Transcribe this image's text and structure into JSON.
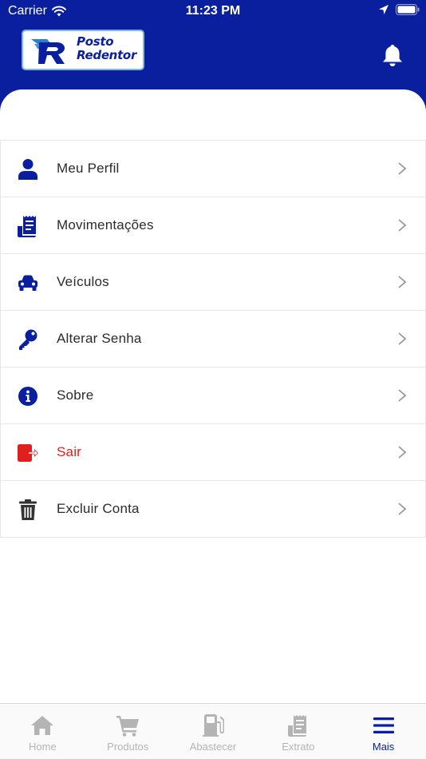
{
  "status_bar": {
    "carrier": "Carrier",
    "time": "11:23 PM"
  },
  "header": {
    "logo_line1": "Posto",
    "logo_line2": "Redentor",
    "brand_color": "#0a1f9e",
    "notification_icon": "bell-icon"
  },
  "menu": {
    "items": [
      {
        "label": "Meu Perfil",
        "icon": "user-icon"
      },
      {
        "label": "Movimentações",
        "icon": "receipt-icon"
      },
      {
        "label": "Veículos",
        "icon": "car-icon"
      },
      {
        "label": "Alterar Senha",
        "icon": "key-icon"
      },
      {
        "label": "Sobre",
        "icon": "info-icon"
      },
      {
        "label": "Sair",
        "icon": "logout-icon",
        "color": "#e0201f"
      },
      {
        "label": "Excluir Conta",
        "icon": "trash-icon"
      }
    ]
  },
  "tabbar": {
    "tabs": [
      {
        "label": "Home",
        "icon": "home-icon"
      },
      {
        "label": "Produtos",
        "icon": "cart-icon"
      },
      {
        "label": "Abastecer",
        "icon": "fuel-pump-icon"
      },
      {
        "label": "Extrato",
        "icon": "receipt-icon"
      },
      {
        "label": "Mais",
        "icon": "menu-icon",
        "active": true
      }
    ]
  }
}
